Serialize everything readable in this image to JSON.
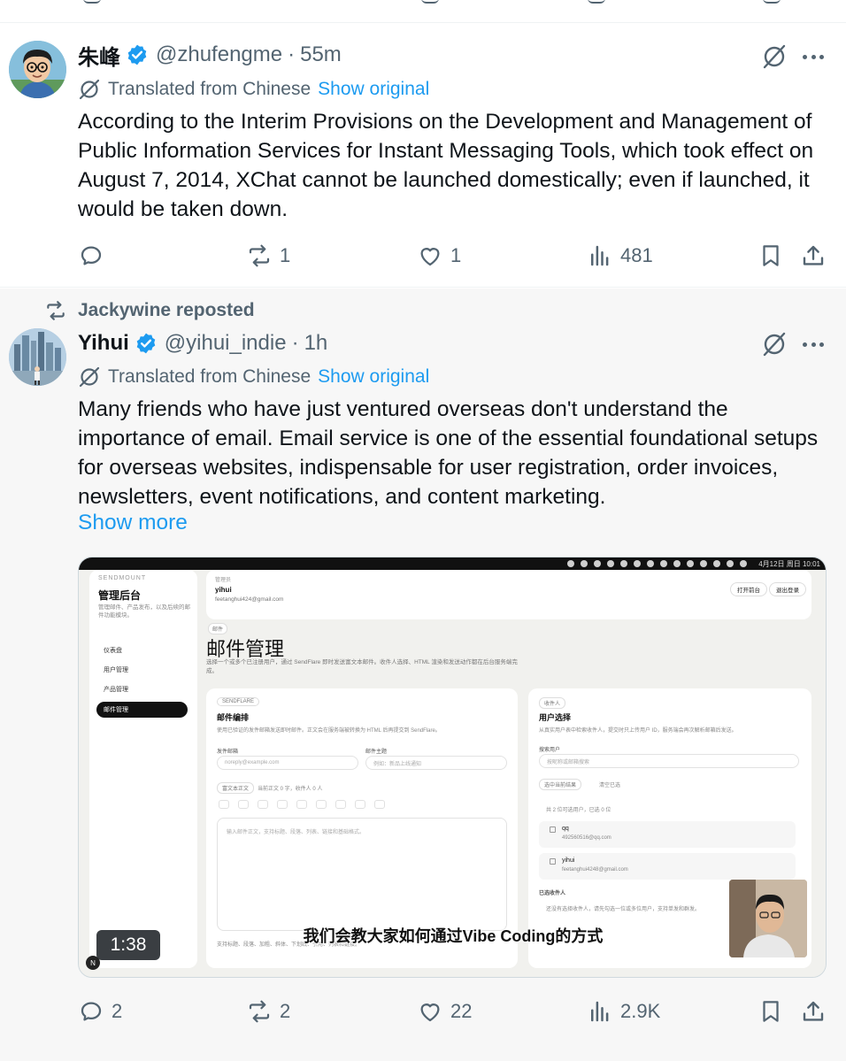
{
  "tweet1": {
    "name": "朱峰",
    "handle": "@zhufengme",
    "separator": "·",
    "time": "55m",
    "translated_label": "Translated from Chinese",
    "show_original": "Show original",
    "body": "According to the Interim Provisions on the Development and Management of Public Information Services for Instant Messaging Tools, which took effect on August 7, 2014, XChat cannot be launched domestically; even if launched, it would be taken down.",
    "replies": "",
    "reposts": "1",
    "likes": "1",
    "views": "481"
  },
  "tweet2": {
    "reposted_by": "Jackywine reposted",
    "name": "Yihui",
    "handle": "@yihui_indie",
    "separator": "·",
    "time": "1h",
    "translated_label": "Translated from Chinese",
    "show_original": "Show original",
    "body": "Many friends who have just ventured overseas don't understand the importance of email. Email service is one of the essential foundational setups for overseas websites, indispensable for user registration, order invoices, newsletters, event notifications, and content marketing.",
    "show_more": "Show more",
    "replies": "2",
    "reposts": "2",
    "likes": "22",
    "views": "2.9K",
    "video": {
      "duration": "1:38",
      "caption": "我们会教大家如何通过Vibe Coding的方式",
      "badge": "N",
      "menubar_time": "4月12日 周日 10:01",
      "screen": {
        "sidebar": {
          "brand": "SENDMOUNT",
          "title": "管理后台",
          "subtitle": "管理邮件、产品发布，以及后续的邮件功能模块。",
          "items": [
            "仪表盘",
            "用户管理",
            "产品管理",
            "邮件管理"
          ]
        },
        "header": {
          "label": "管理员",
          "user": "yihui",
          "email": "feetanghui424@gmail.com",
          "btn_home": "打开前台",
          "btn_logout": "退出登录"
        },
        "page_tag": "邮件",
        "page_title": "邮件管理",
        "page_desc": "选择一个或多个已注册用户，通过 SendFlare 即时发送富文本邮件。收件人选择、HTML 渲染和发送动作都在后台服务端完成。",
        "compose": {
          "tag": "SENDFLARE",
          "title": "邮件编排",
          "sub": "使用已验证的发件邮箱发送即时邮件。正文会在服务端被转换为 HTML 后再提交到 SendFlare。",
          "from_label": "发件邮箱",
          "from_placeholder": "noreply@example.com",
          "subject_label": "邮件主题",
          "subject_placeholder": "例如：新品上线通知",
          "mode_label": "富文本正文",
          "mode_info": "当前正文 0 字，收件人 0 人",
          "body_placeholder": "输入邮件正文，支持标题、段落、列表、链接和基础格式。",
          "footer": "支持标题、段落、加粗、斜体、下划线、引用、列表和链接。"
        },
        "recipients": {
          "tag": "收件人",
          "title": "用户选择",
          "sub": "从真实用户表中检索收件人，提交时只上传用户 ID，服务端会再次解析邮箱后发送。",
          "search_label": "搜索用户",
          "search_placeholder": "按昵称或邮箱搜索",
          "select_btn": "选中当前结果",
          "clear_btn": "清空已选",
          "count_info": "共 2 位可选用户，已选 0 位",
          "users": [
            {
              "name": "qq",
              "email": "492560516@qq.com"
            },
            {
              "name": "yihui",
              "email": "feetanghui4248@gmail.com"
            }
          ],
          "selected_label": "已选收件人",
          "selected_hint": "还没有选择收件人，请先勾选一位或多位用户，支持单发和群发。"
        }
      }
    }
  },
  "colors": {
    "text_primary": "#0f1419",
    "text_secondary": "#536471",
    "accent": "#1d9bf0",
    "verified": "#1d9bf0"
  },
  "icons": {
    "verified": "verified-badge-icon",
    "grok": "grok-icon",
    "more": "more-icon",
    "translate": "translate-icon",
    "reply": "reply-icon",
    "repost": "repost-icon",
    "like": "heart-icon",
    "views": "views-icon",
    "bookmark": "bookmark-icon",
    "share": "share-icon"
  }
}
